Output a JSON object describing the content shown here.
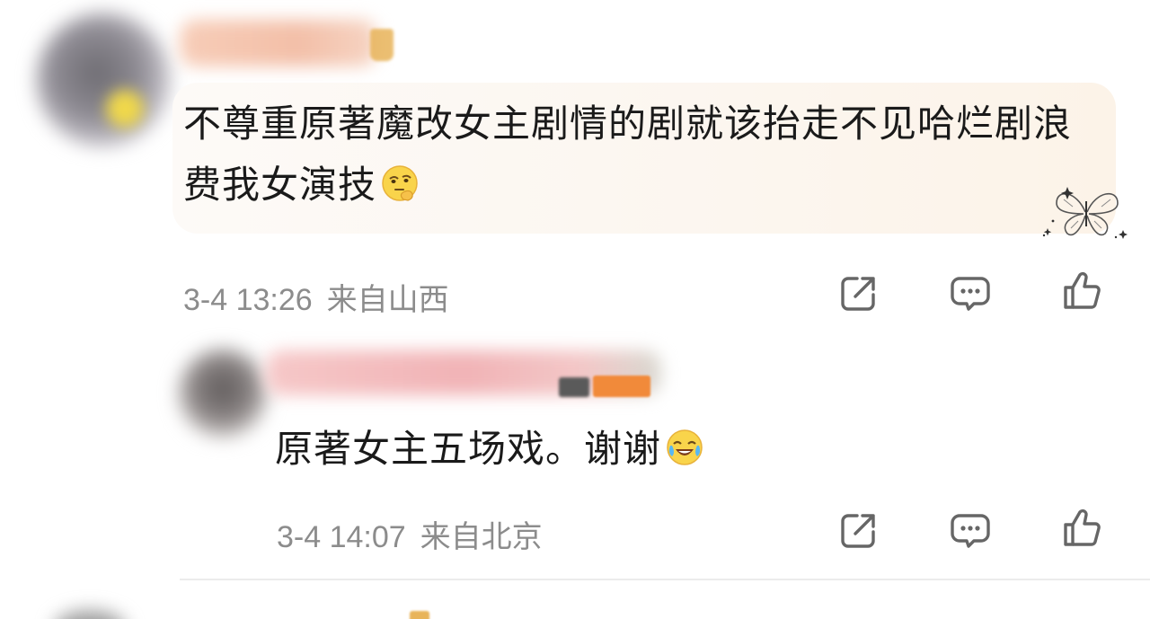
{
  "comment": {
    "text": "不尊重原著魔改女主剧情的剧就该抬走不见哈烂剧浪费我女演技",
    "emoji": "thinking-face-emoji",
    "time": "3-4 13:26",
    "location": "来自山西",
    "actions": [
      "share-icon",
      "reply-comment-icon",
      "like-icon"
    ]
  },
  "reply": {
    "text": "原著女主五场戏。谢谢",
    "emoji": "laughing-crying-face-emoji",
    "time": "3-4 14:07",
    "location": "来自北京",
    "actions": [
      "share-icon",
      "reply-comment-icon",
      "like-icon"
    ]
  },
  "colors": {
    "text": "#1a1a1a",
    "meta": "#8c8c8c",
    "bubble": "#fcf6ef"
  }
}
